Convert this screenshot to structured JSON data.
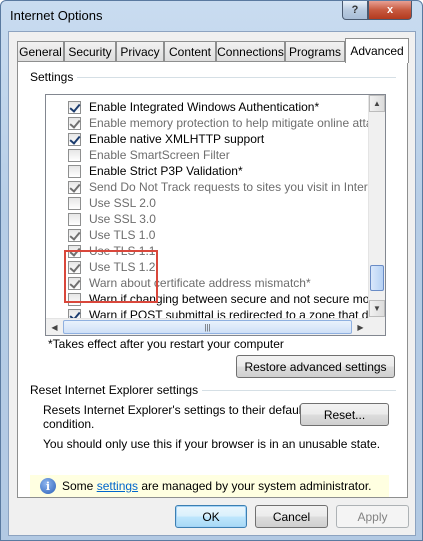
{
  "window": {
    "title": "Internet Options"
  },
  "tabs": [
    "General",
    "Security",
    "Privacy",
    "Content",
    "Connections",
    "Programs",
    "Advanced"
  ],
  "settings": {
    "label": "Settings",
    "items": [
      {
        "label": "Enable Integrated Windows Authentication*",
        "checked": true,
        "disabled": false
      },
      {
        "label": "Enable memory protection to help mitigate online attacks*",
        "checked": true,
        "disabled": true
      },
      {
        "label": "Enable native XMLHTTP support",
        "checked": true,
        "disabled": false
      },
      {
        "label": "Enable SmartScreen Filter",
        "checked": false,
        "disabled": true
      },
      {
        "label": "Enable Strict P3P Validation*",
        "checked": false,
        "disabled": false
      },
      {
        "label": "Send Do Not Track requests to sites you visit in Internet E",
        "checked": true,
        "disabled": true
      },
      {
        "label": "Use SSL 2.0",
        "checked": false,
        "disabled": true
      },
      {
        "label": "Use SSL 3.0",
        "checked": false,
        "disabled": true
      },
      {
        "label": "Use TLS 1.0",
        "checked": true,
        "disabled": true
      },
      {
        "label": "Use TLS 1.1",
        "checked": true,
        "disabled": true
      },
      {
        "label": "Use TLS 1.2",
        "checked": true,
        "disabled": true
      },
      {
        "label": "Warn about certificate address mismatch*",
        "checked": true,
        "disabled": true
      },
      {
        "label": "Warn if changing between secure and not secure mode",
        "checked": false,
        "disabled": false
      },
      {
        "label": "Warn if POST submittal is redirected to a zone that does n",
        "checked": true,
        "disabled": false
      }
    ],
    "note": "*Takes effect after you restart your computer",
    "restore_button": "Restore advanced settings"
  },
  "reset": {
    "group_label": "Reset Internet Explorer settings",
    "description_line1": "Resets Internet Explorer's settings to their default",
    "description_line2": "condition.",
    "button": "Reset...",
    "warning": "You should only use this if your browser is in an unusable state."
  },
  "infobar": {
    "prefix": "Some ",
    "link": "settings",
    "suffix": " are managed by your system administrator."
  },
  "footer": {
    "ok": "OK",
    "cancel": "Cancel",
    "apply": "Apply"
  },
  "colors": {
    "highlight_box": "#d9473b",
    "link": "#0066cc",
    "infobar_bg": "#ffffe1"
  },
  "icons": {
    "help": "?",
    "close": "x",
    "info": "i"
  }
}
